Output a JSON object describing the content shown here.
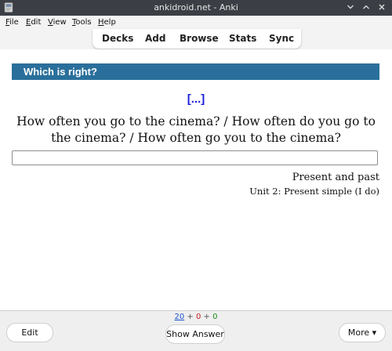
{
  "window": {
    "title": "ankidroid.net - Anki",
    "controls": [
      "chevron-down-icon",
      "chevron-up-icon",
      "close-icon"
    ]
  },
  "menu": {
    "items": [
      "File",
      "Edit",
      "View",
      "Tools",
      "Help"
    ]
  },
  "toolbar": {
    "items": [
      "Decks",
      "Add",
      "Browse",
      "Stats",
      "Sync"
    ]
  },
  "card": {
    "header": "Which is right?",
    "cloze": "[...]",
    "question": "How often you go to the cinema? / How often do you go to the cinema? / How often go you to the cinema?",
    "answer_value": "",
    "meta_line1": "Present and past",
    "meta_line2": "Unit 2: Present simple (I do)"
  },
  "counts": {
    "new": "20",
    "learning": "0",
    "review": "0",
    "separator": "+"
  },
  "buttons": {
    "edit": "Edit",
    "show_answer": "Show Answer",
    "more": "More ▾"
  },
  "colors": {
    "header_bg": "#2a6f9b",
    "cloze": "#1c1ed9",
    "count_new": "#1a55d0",
    "count_learning": "#c21f1f",
    "count_review": "#1f8a1f"
  }
}
